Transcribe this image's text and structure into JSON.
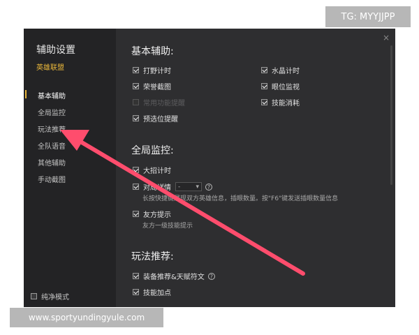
{
  "watermarks": {
    "top": "TG: MYYJJPP",
    "bottom": "www.sportyundingyule.com"
  },
  "sidebar": {
    "title": "辅助设置",
    "game": "英雄联盟",
    "items": [
      {
        "label": "基本辅助",
        "active": true
      },
      {
        "label": "全局监控"
      },
      {
        "label": "玩法推荐"
      },
      {
        "label": "全队语音"
      },
      {
        "label": "其他辅助"
      },
      {
        "label": "手动截图"
      }
    ],
    "pure_mode": {
      "label": "纯净模式",
      "checked": false
    }
  },
  "main": {
    "sections": [
      {
        "title": "基本辅助:",
        "options": [
          {
            "label": "打野计时",
            "checked": true
          },
          {
            "label": "水晶计时",
            "checked": true
          },
          {
            "label": "荣誉截图",
            "checked": true
          },
          {
            "label": "眼位监视",
            "checked": true
          },
          {
            "label": "常用功能提醒",
            "checked": false,
            "disabled": true
          },
          {
            "label": "技能消耗",
            "checked": true
          },
          {
            "label": "预选位提醒",
            "checked": true
          }
        ]
      },
      {
        "title": "全局监控:",
        "options": [
          {
            "label": "大招计时",
            "checked": true
          },
          {
            "label": "对局详情",
            "checked": true,
            "dropdown_value": "-",
            "desc": "长按快捷键展现双方英雄信息，插眼数量。按\"F6\"键发送插眼数量信息"
          },
          {
            "label": "友方提示",
            "checked": true,
            "desc": "友方一级技能提示"
          }
        ]
      },
      {
        "title": "玩法推荐:",
        "options": [
          {
            "label": "装备推荐&天赋符文",
            "checked": true
          },
          {
            "label": "技能加点",
            "checked": true
          }
        ]
      }
    ]
  },
  "colors": {
    "accent": "#e7b53a",
    "arrow": "#ff4d6d"
  },
  "icons": {
    "close": "×",
    "help": "?",
    "dropdown": "▾"
  }
}
